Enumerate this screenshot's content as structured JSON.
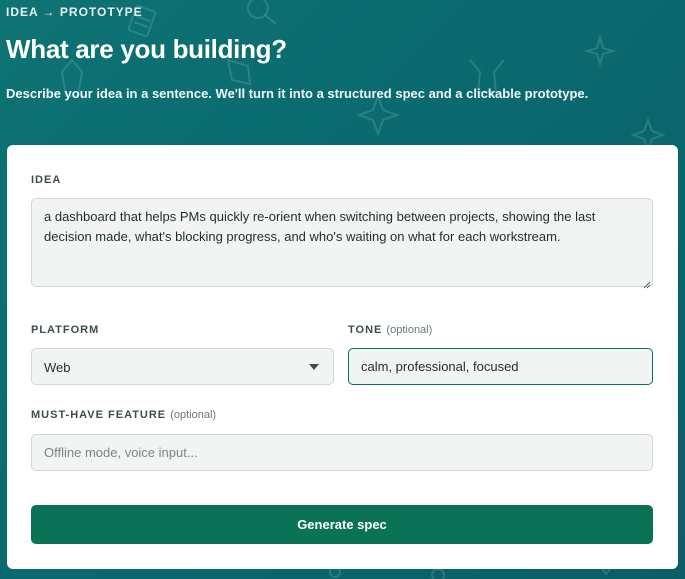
{
  "header": {
    "eyebrow": "IDEA → PROTOTYPE",
    "title": "What are you building?",
    "subtitle": "Describe your idea in a sentence. We'll turn it into a structured spec and a clickable prototype."
  },
  "form": {
    "idea": {
      "label": "IDEA",
      "value": "a dashboard that helps PMs quickly re-orient when switching between projects, showing the last decision made, what's blocking progress, and who's waiting on what for each workstream."
    },
    "platform": {
      "label": "PLATFORM",
      "selected": "Web"
    },
    "tone": {
      "label": "TONE",
      "optional": "(optional)",
      "value": "calm, professional, focused"
    },
    "must_have": {
      "label": "MUST-HAVE FEATURE",
      "optional": "(optional)",
      "placeholder": "Offline mode, voice input..."
    },
    "submit_label": "Generate spec"
  },
  "colors": {
    "background": "#0e7373",
    "accent": "#0b7355",
    "card": "#ffffff",
    "field_bg": "#f1f4f2"
  }
}
